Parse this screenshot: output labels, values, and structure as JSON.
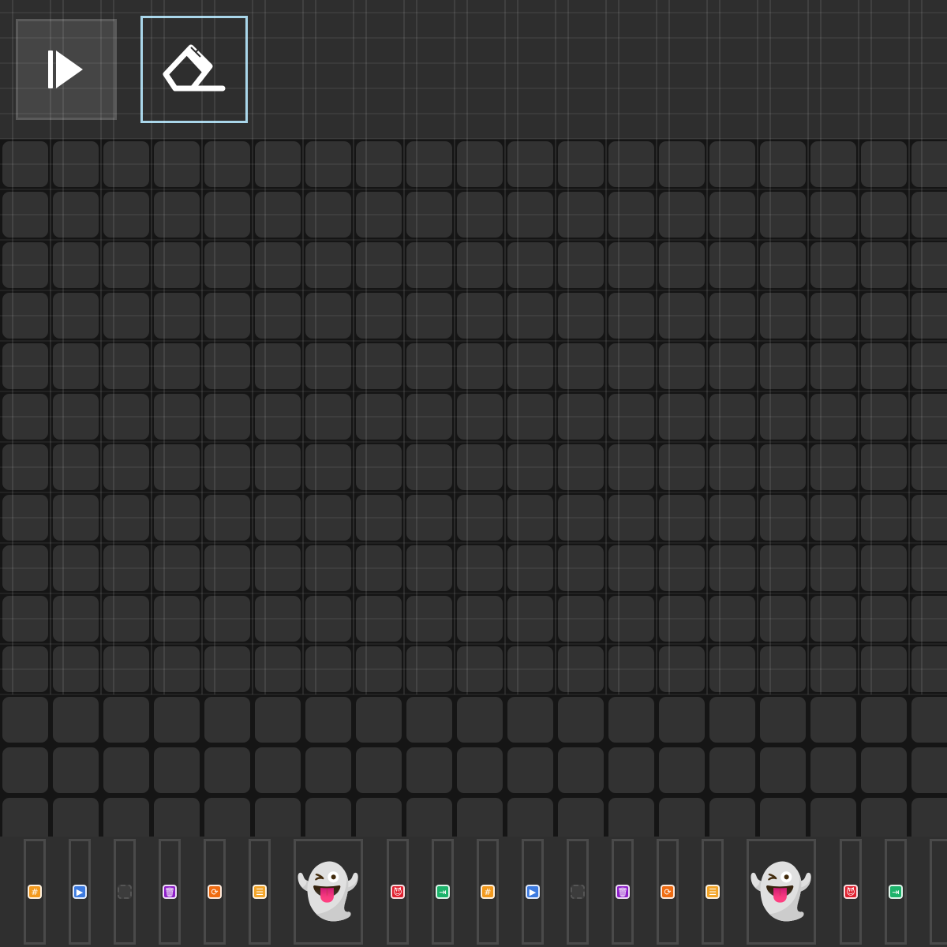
{
  "toolbar": {
    "tools": [
      {
        "name": "play-button",
        "icon": "play-icon",
        "selected": false
      },
      {
        "name": "eraser-button",
        "icon": "eraser-icon",
        "selected": true
      }
    ]
  },
  "grid": {
    "columns": 19,
    "rows": 14
  },
  "palette": {
    "items": [
      {
        "kind": "chip",
        "icon": "grid-block-icon",
        "color": "#f39a1e",
        "glyph": "#"
      },
      {
        "kind": "chip",
        "icon": "play-block-icon",
        "color": "#3d7be0",
        "glyph": "▶"
      },
      {
        "kind": "chip",
        "icon": "empty-block-icon",
        "color": "#3c3c3c",
        "glyph": ""
      },
      {
        "kind": "chip",
        "icon": "trash-block-icon",
        "color": "#8e1fc9",
        "glyph": "🗑"
      },
      {
        "kind": "chip",
        "icon": "cycle-block-icon",
        "color": "#ef6c12",
        "glyph": "⟳"
      },
      {
        "kind": "chip",
        "icon": "lines-block-icon",
        "color": "#f2a52a",
        "glyph": "☰"
      },
      {
        "kind": "ghost",
        "icon": "ghost-icon",
        "glyph": "👻"
      },
      {
        "kind": "chip",
        "icon": "devil-block-icon",
        "color": "#e0202f",
        "glyph": "😈"
      },
      {
        "kind": "chip",
        "icon": "exit-block-icon",
        "color": "#1db36b",
        "glyph": "⇥"
      },
      {
        "kind": "chip",
        "icon": "grid-block-icon",
        "color": "#f39a1e",
        "glyph": "#"
      },
      {
        "kind": "chip",
        "icon": "play-block-icon",
        "color": "#3d7be0",
        "glyph": "▶"
      },
      {
        "kind": "chip",
        "icon": "empty-block-icon",
        "color": "#3c3c3c",
        "glyph": ""
      },
      {
        "kind": "chip",
        "icon": "trash-block-icon",
        "color": "#8e1fc9",
        "glyph": "🗑"
      },
      {
        "kind": "chip",
        "icon": "cycle-block-icon",
        "color": "#ef6c12",
        "glyph": "⟳"
      },
      {
        "kind": "chip",
        "icon": "lines-block-icon",
        "color": "#f2a52a",
        "glyph": "☰"
      },
      {
        "kind": "ghost",
        "icon": "ghost-icon",
        "glyph": "👻"
      },
      {
        "kind": "chip",
        "icon": "devil-block-icon",
        "color": "#e0202f",
        "glyph": "😈"
      },
      {
        "kind": "chip",
        "icon": "exit-block-icon",
        "color": "#1db36b",
        "glyph": "⇥"
      },
      {
        "kind": "empty",
        "icon": "empty-slot"
      }
    ]
  },
  "colors": {
    "accent_selected": "#a9d6ea",
    "cell": "#323232",
    "grid_background": "#151515"
  }
}
